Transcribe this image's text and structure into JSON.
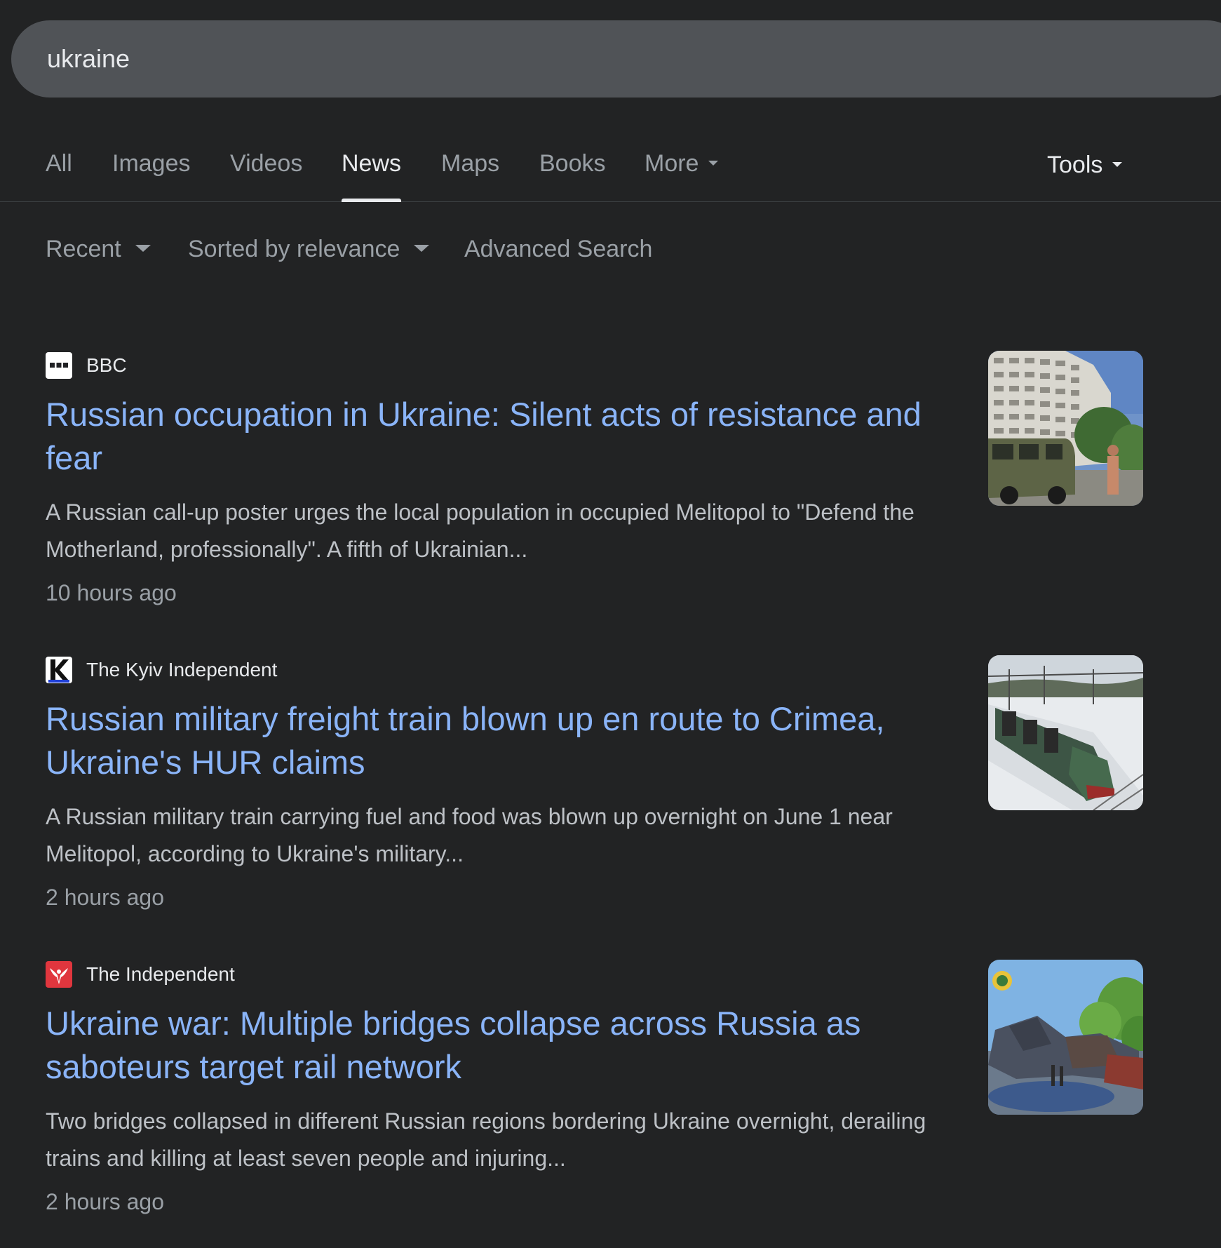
{
  "search": {
    "query": "ukraine"
  },
  "tabs": [
    {
      "label": "All"
    },
    {
      "label": "Images"
    },
    {
      "label": "Videos"
    },
    {
      "label": "News"
    },
    {
      "label": "Maps"
    },
    {
      "label": "Books"
    },
    {
      "label": "More"
    }
  ],
  "active_tab": "News",
  "tools": {
    "label": "Tools"
  },
  "filters": {
    "time": "Recent",
    "sort": "Sorted by relevance",
    "advanced": "Advanced Search"
  },
  "results": [
    {
      "source": "BBC",
      "favicon": "bbc-icon",
      "headline": "Russian occupation in Ukraine: Silent acts of resistance and fear",
      "snippet": "A Russian call-up poster urges the local population in occupied Melitopol to \"Defend the Motherland, professionally\". A fifth of Ukrainian...",
      "time": "10 hours ago",
      "thumbnail": "apartment-building-van-thumbnail"
    },
    {
      "source": "The Kyiv Independent",
      "favicon": "kyiv-independent-icon",
      "headline": "Russian military freight train blown up en route to Crimea, Ukraine's HUR claims",
      "snippet": "A Russian military train carrying fuel and food was blown up overnight on June 1 near Melitopol, according to Ukraine's military...",
      "time": "2 hours ago",
      "thumbnail": "freight-train-snow-thumbnail"
    },
    {
      "source": "The Independent",
      "favicon": "independent-eagle-icon",
      "headline": "Ukraine war: Multiple bridges collapse across Russia as saboteurs target rail network",
      "snippet": "Two bridges collapsed in different Russian regions bordering Ukraine overnight, derailing trains and killing at least seven people and injuring...",
      "time": "2 hours ago",
      "thumbnail": "train-wreck-thumbnail"
    }
  ],
  "colors": {
    "background": "#222324",
    "search_bar": "#505357",
    "link": "#8ab4f8",
    "text": "#bdc1c6",
    "muted": "#9aa0a6",
    "bright": "#e8eaed"
  }
}
